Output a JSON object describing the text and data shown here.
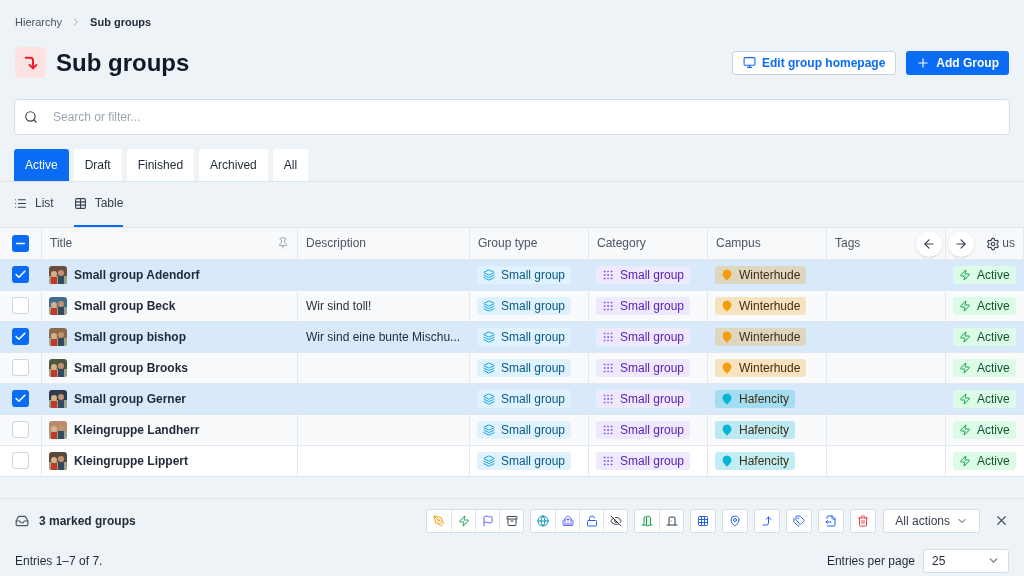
{
  "breadcrumb": [
    "Hierarchy",
    "Sub groups"
  ],
  "title": "Sub groups",
  "header_buttons": [
    {
      "kind": "secondary",
      "label": "Edit group homepage"
    },
    {
      "kind": "primary",
      "label": "Add Group"
    }
  ],
  "search": {
    "placeholder": "Search or filter..."
  },
  "status_tabs": [
    {
      "label": "Active",
      "selected": true
    },
    {
      "label": "Draft",
      "selected": false
    },
    {
      "label": "Finished",
      "selected": false
    },
    {
      "label": "Archived",
      "selected": false
    },
    {
      "label": "All",
      "selected": false
    }
  ],
  "view_tabs": [
    {
      "label": "List",
      "kind": "list",
      "selected": false
    },
    {
      "label": "Table",
      "kind": "table",
      "selected": true
    }
  ],
  "table": {
    "select_all": {
      "checked": true,
      "partial": true
    },
    "columns": [
      "Title",
      "Description",
      "Group type",
      "Category",
      "Campus",
      "Tags",
      "us"
    ],
    "rows": [
      {
        "selected": true,
        "title": "Small group Adendorf",
        "description": "",
        "group_type": "Small group",
        "category": "Small group",
        "campus": {
          "label": "Winterhude",
          "color": "#f59e0b"
        },
        "status": "Active"
      },
      {
        "selected": false,
        "title": "Small group Beck",
        "description": "Wir sind toll!",
        "group_type": "Small group",
        "category": "Small group",
        "campus": {
          "label": "Winterhude",
          "color": "#f59e0b"
        },
        "status": "Active"
      },
      {
        "selected": true,
        "title": "Small group bishop",
        "description": "Wir sind eine bunte Mischu...",
        "group_type": "Small group",
        "category": "Small group",
        "campus": {
          "label": "Winterhude",
          "color": "#f59e0b"
        },
        "status": "Active"
      },
      {
        "selected": false,
        "title": "Small group Brooks",
        "description": "",
        "group_type": "Small group",
        "category": "Small group",
        "campus": {
          "label": "Winterhude",
          "color": "#f59e0b"
        },
        "status": "Active"
      },
      {
        "selected": true,
        "title": "Small group Gerner",
        "description": "",
        "group_type": "Small group",
        "category": "Small group",
        "campus": {
          "label": "Hafencity",
          "color": "#06b6d4"
        },
        "status": "Active"
      },
      {
        "selected": false,
        "title": "Kleingruppe Landherr",
        "description": "",
        "group_type": "Small group",
        "category": "Small group",
        "campus": {
          "label": "Hafencity",
          "color": "#06b6d4"
        },
        "status": "Active"
      },
      {
        "selected": false,
        "title": "Kleingruppe Lippert",
        "description": "",
        "group_type": "Small group",
        "category": "Small group",
        "campus": {
          "label": "Hafencity",
          "color": "#06b6d4"
        },
        "status": "Active"
      }
    ]
  },
  "bulk_bar": {
    "label": "3 marked groups",
    "all_actions": "All actions"
  },
  "footer": {
    "entries": "Entries 1–7 of 7.",
    "per_page_label": "Entries per page",
    "per_page": "25"
  }
}
